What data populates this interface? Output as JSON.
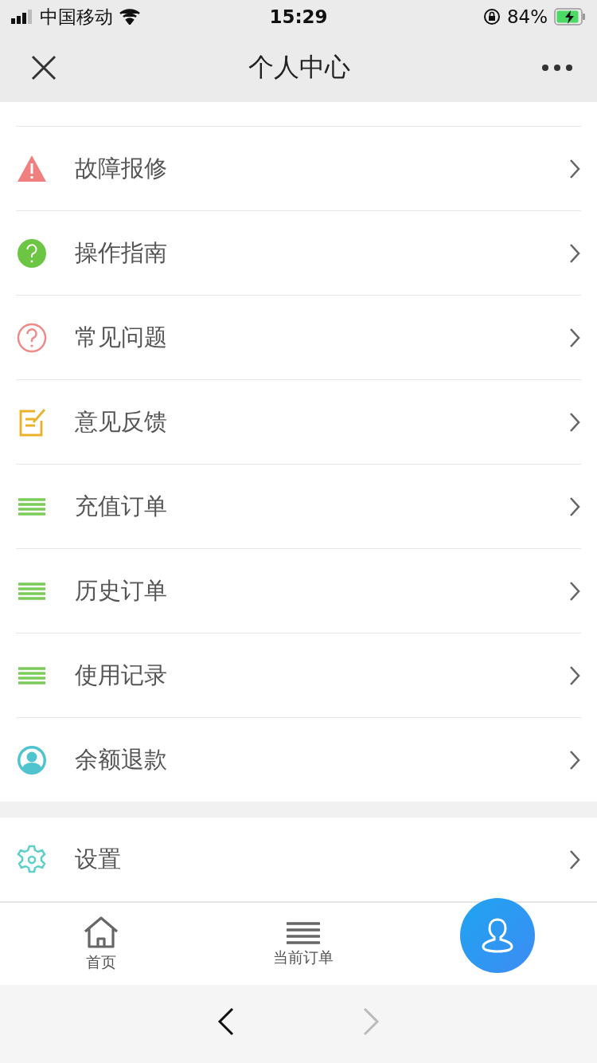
{
  "status_bar": {
    "carrier": "中国移动",
    "time": "15:29",
    "battery": "84%"
  },
  "nav": {
    "title": "个人中心"
  },
  "menu": [
    {
      "label": "故障报修",
      "kind": "warning",
      "color": "#f08080"
    },
    {
      "label": "操作指南",
      "kind": "help-solid",
      "color": "#6cc644"
    },
    {
      "label": "常见问题",
      "kind": "help-outline",
      "color": "#ee8a8a"
    },
    {
      "label": "意见反馈",
      "kind": "edit",
      "color": "#e9b22a"
    },
    {
      "label": "充值订单",
      "kind": "list",
      "color": "#7acb5a"
    },
    {
      "label": "历史订单",
      "kind": "list",
      "color": "#7acb5a"
    },
    {
      "label": "使用记录",
      "kind": "list",
      "color": "#7acb5a"
    },
    {
      "label": "余额退款",
      "kind": "user",
      "color": "#4fc4cf"
    }
  ],
  "settings": [
    {
      "label": "设置",
      "kind": "gear",
      "color": "#5ccfc9"
    }
  ],
  "tabs": [
    {
      "label": "首页",
      "kind": "home",
      "selected": false
    },
    {
      "label": "当前订单",
      "kind": "list",
      "selected": false
    },
    {
      "kind": "user",
      "selected": true
    }
  ],
  "browser": {
    "back_disabled": false,
    "forward_disabled": true
  }
}
